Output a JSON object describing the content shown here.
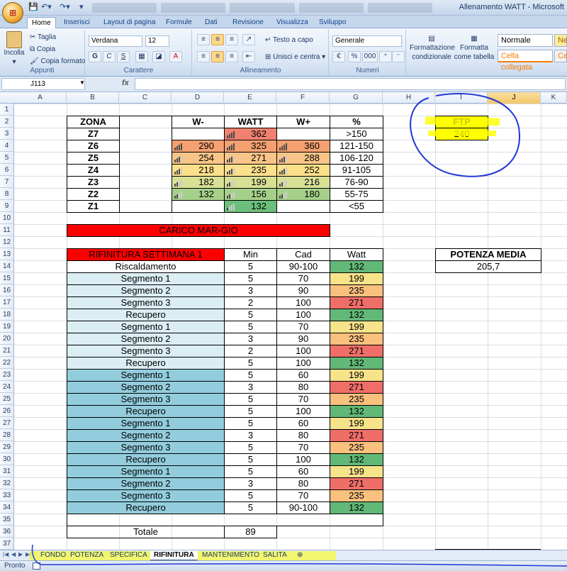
{
  "window": {
    "title": "Allenamento WATT - Microsoft"
  },
  "ribbon_tabs": [
    "Home",
    "Inserisci",
    "Layout di pagina",
    "Formule",
    "Dati",
    "Revisione",
    "Visualizza",
    "Sviluppo"
  ],
  "clipboard": {
    "paste": "Incolla",
    "cut": "Taglia",
    "copy": "Copia",
    "format_painter": "Copia formato",
    "label": "Appunti"
  },
  "font": {
    "name": "Verdana",
    "size": "12",
    "label": "Carattere",
    "bold": "G",
    "italic": "C",
    "underline": "S"
  },
  "alignment": {
    "wrap": "Testo a capo",
    "merge": "Unisci e centra",
    "label": "Allineamento"
  },
  "number": {
    "format": "Generale",
    "label": "Numeri",
    "percent": "%",
    "thousands": "000"
  },
  "styles": {
    "conditional": "Formattazione condizionale",
    "table": "Formatta come tabella",
    "normal": "Normale",
    "linked": "Cella collegata",
    "neutral": "Ne",
    "calc": "Ce"
  },
  "formula_bar": {
    "name_box": "J113",
    "fx": "fx"
  },
  "columns": [
    "A",
    "B",
    "C",
    "D",
    "E",
    "F",
    "G",
    "H",
    "I",
    "J",
    "K"
  ],
  "zones": {
    "headers": [
      "ZONA",
      "W-",
      "WATT",
      "W+",
      "%"
    ],
    "rows": [
      {
        "zona": "Z7",
        "wminus": "",
        "watt": "362",
        "wplus": "",
        "pct": ">150"
      },
      {
        "zona": "Z6",
        "wminus": "290",
        "watt": "325",
        "wplus": "360",
        "pct": "121-150"
      },
      {
        "zona": "Z5",
        "wminus": "254",
        "watt": "271",
        "wplus": "288",
        "pct": "106-120"
      },
      {
        "zona": "Z4",
        "wminus": "218",
        "watt": "235",
        "wplus": "252",
        "pct": "91-105"
      },
      {
        "zona": "Z3",
        "wminus": "182",
        "watt": "199",
        "wplus": "216",
        "pct": "76-90"
      },
      {
        "zona": "Z2",
        "wminus": "132",
        "watt": "156",
        "wplus": "180",
        "pct": "55-75"
      },
      {
        "zona": "Z1",
        "wminus": "",
        "watt": "132",
        "wplus": "",
        "pct": "<55"
      }
    ]
  },
  "ftp": {
    "label": "FTP",
    "value": "240"
  },
  "carico": "CARICO MAR-GIO",
  "workout": {
    "title": "RIFINITURA SETTIMANA 1",
    "headers": [
      "Min",
      "Cad",
      "Watt"
    ],
    "rows": [
      {
        "name": "Riscaldamento",
        "min": "5",
        "cad": "90-100",
        "watt": "132"
      },
      {
        "name": "Segmento 1",
        "min": "5",
        "cad": "70",
        "watt": "199"
      },
      {
        "name": "Segmento 2",
        "min": "3",
        "cad": "90",
        "watt": "235"
      },
      {
        "name": "Segmento 3",
        "min": "2",
        "cad": "100",
        "watt": "271"
      },
      {
        "name": "Recupero",
        "min": "5",
        "cad": "100",
        "watt": "132"
      },
      {
        "name": "Segmento 1",
        "min": "5",
        "cad": "70",
        "watt": "199"
      },
      {
        "name": "Segmento 2",
        "min": "3",
        "cad": "90",
        "watt": "235"
      },
      {
        "name": "Segmento 3",
        "min": "2",
        "cad": "100",
        "watt": "271"
      },
      {
        "name": "Recupero",
        "min": "5",
        "cad": "100",
        "watt": "132"
      },
      {
        "name": "Segmento 1",
        "min": "5",
        "cad": "60",
        "watt": "199"
      },
      {
        "name": "Segmento 2",
        "min": "3",
        "cad": "80",
        "watt": "271"
      },
      {
        "name": "Segmento 3",
        "min": "5",
        "cad": "70",
        "watt": "235"
      },
      {
        "name": "Recupero",
        "min": "5",
        "cad": "100",
        "watt": "132"
      },
      {
        "name": "Segmento 1",
        "min": "5",
        "cad": "60",
        "watt": "199"
      },
      {
        "name": "Segmento 2",
        "min": "3",
        "cad": "80",
        "watt": "271"
      },
      {
        "name": "Segmento 3",
        "min": "5",
        "cad": "70",
        "watt": "235"
      },
      {
        "name": "Recupero",
        "min": "5",
        "cad": "100",
        "watt": "132"
      },
      {
        "name": "Segmento 1",
        "min": "5",
        "cad": "60",
        "watt": "199"
      },
      {
        "name": "Segmento 2",
        "min": "3",
        "cad": "80",
        "watt": "271"
      },
      {
        "name": "Segmento 3",
        "min": "5",
        "cad": "70",
        "watt": "235"
      },
      {
        "name": "Recupero",
        "min": "5",
        "cad": "90-100",
        "watt": "132"
      }
    ],
    "total_label": "Totale",
    "total_value": "89"
  },
  "potenza": {
    "label": "POTENZA MEDIA",
    "value": "205,7"
  },
  "sheet_tabs": [
    "FONDO",
    "POTENZA",
    "SPECIFICA",
    "RIFINITURA",
    "MANTENIMENTO",
    "SALITA"
  ],
  "active_sheet": "RIFINITURA",
  "status": "Pronto",
  "colors": {
    "z7": "#f08070",
    "z6": "#f4a070",
    "z5": "#f8c488",
    "z4": "#fde08c",
    "z3": "#d8e096",
    "z2": "#a6d08a",
    "z1": "#6cc07c",
    "w132": "#62b876",
    "w199": "#f6e38a",
    "w235": "#f9c07e",
    "w271": "#f06e68",
    "red": "#ff0000",
    "ftp": "#ffff00",
    "light": "#dbeef3",
    "mid": "#93cddd"
  }
}
